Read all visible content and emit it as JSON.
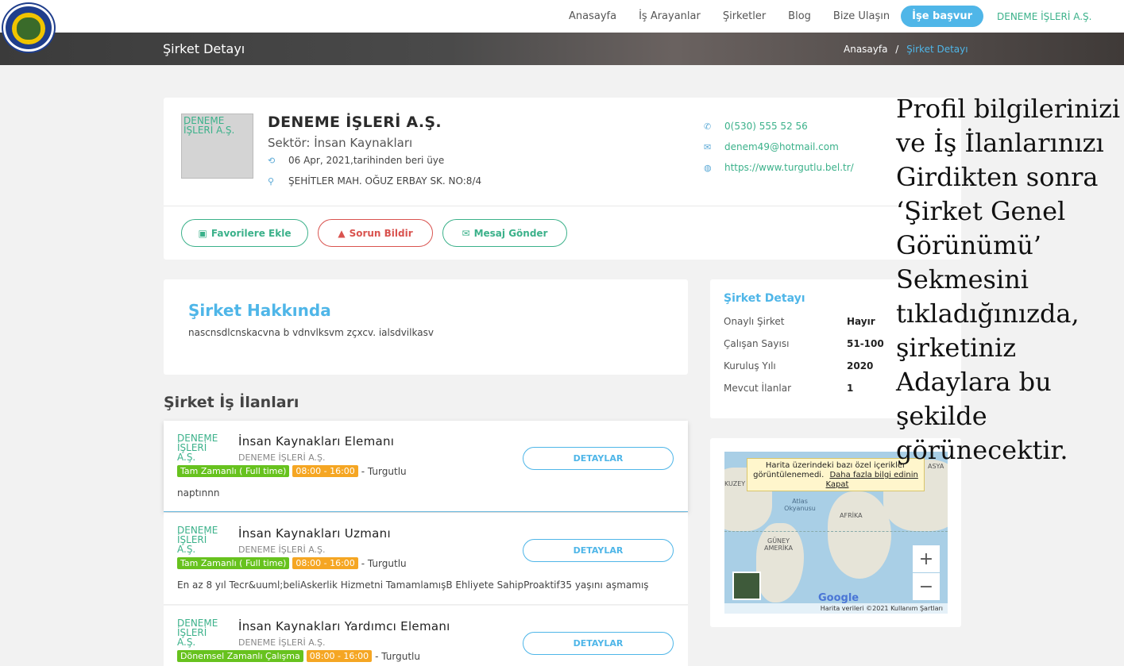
{
  "nav": {
    "links": [
      "Anasayfa",
      "İş Arayanlar",
      "Şirketler",
      "Blog",
      "Bize Ulaşın"
    ],
    "apply": "İşe başvur",
    "brand": "DENEME İŞLERİ A.Ş."
  },
  "banner": {
    "title": "Şirket Detayı",
    "crumb_home": "Anasayfa",
    "crumb_sep": "/",
    "crumb_current": "Şirket Detayı"
  },
  "company": {
    "logo_alt": "DENEME İŞLERİ A.Ş.",
    "name": "DENEME İŞLERİ A.Ş.",
    "sector": "Sektör: İnsan Kaynakları",
    "since": "06 Apr, 2021,tarihinden beri üye",
    "address": "ŞEHİTLER MAH. OĞUZ ERBAY SK. NO:8/4",
    "phone": "0(530) 555 52 56",
    "email": "denem49@hotmail.com",
    "website": "https://www.turgutlu.bel.tr/",
    "buttons": {
      "favorite": "Favorilere Ekle",
      "report": "Sorun Bildir",
      "message": "Mesaj Gönder"
    }
  },
  "about": {
    "title": "Şirket Hakkında",
    "text": "nascnsdlcnskacvna b vdnvlksvm zçxcv. ialsdvilkasv"
  },
  "jobs_title": "Şirket İş İlanları",
  "jobs": [
    {
      "logo_alt": "DENEME İŞLERİ A.Ş.",
      "title": "İnsan Kaynakları Elemanı",
      "company": "DENEME İŞLERİ A.Ş.",
      "type": "Tam Zamanlı ( Full time)",
      "hours": "08:00 - 16:00",
      "location": "- Turgutlu",
      "desc": "naptınnn",
      "button": "DETAYLAR"
    },
    {
      "logo_alt": "DENEME İŞLERİ A.Ş.",
      "title": "İnsan Kaynakları Uzmanı",
      "company": "DENEME İŞLERİ A.Ş.",
      "type": "Tam Zamanlı ( Full time)",
      "hours": "08:00 - 16:00",
      "location": "- Turgutlu",
      "desc": "En az 8 yıl Tecr&uuml;beliAskerlik Hizmetni TamamlamışB Ehliyete SahipProaktif35 yaşını aşmamış",
      "button": "DETAYLAR"
    },
    {
      "logo_alt": "DENEME İŞLERİ A.Ş.",
      "title": "İnsan Kaynakları Yardımcı Elemanı",
      "company": "DENEME İŞLERİ A.Ş.",
      "type": "Dönemsel Zamanlı Çalışma",
      "hours": "08:00 - 16:00",
      "location": "- Turgutlu",
      "desc": "",
      "button": "DETAYLAR"
    }
  ],
  "side": {
    "title": "Şirket Detayı",
    "rows": [
      {
        "label": "Onaylı Şirket",
        "value": "Hayır"
      },
      {
        "label": "Çalışan Sayısı",
        "value": "51-100"
      },
      {
        "label": "Kuruluş Yılı",
        "value": "2020"
      },
      {
        "label": "Mevcut İlanlar",
        "value": "1"
      }
    ]
  },
  "map": {
    "notice": "Harita üzerindeki bazı özel içerikler görüntülenemedi.",
    "notice_link": "Daha fazla bilgi edinin",
    "notice_close": "Kapat",
    "labels": {
      "atlas": "Atlas Okyanusu",
      "africa": "AFRİKA",
      "south_america": "GÜNEY AMERİKA",
      "north_america": "KUZEY AMERİKA",
      "asia": "ASYA"
    },
    "google": "Google",
    "attribution": "Harita verileri ©2021   Kullanım Şartları",
    "zoom_in": "+",
    "zoom_out": "−"
  },
  "note": "Profil bilgilerinizi ve İş İlanlarınızı Girdikten sonra ‘Şirket Genel Görünümü’ Sekmesini tıkladığınızda, şirketiniz Adaylara bu şekilde görünecektir."
}
